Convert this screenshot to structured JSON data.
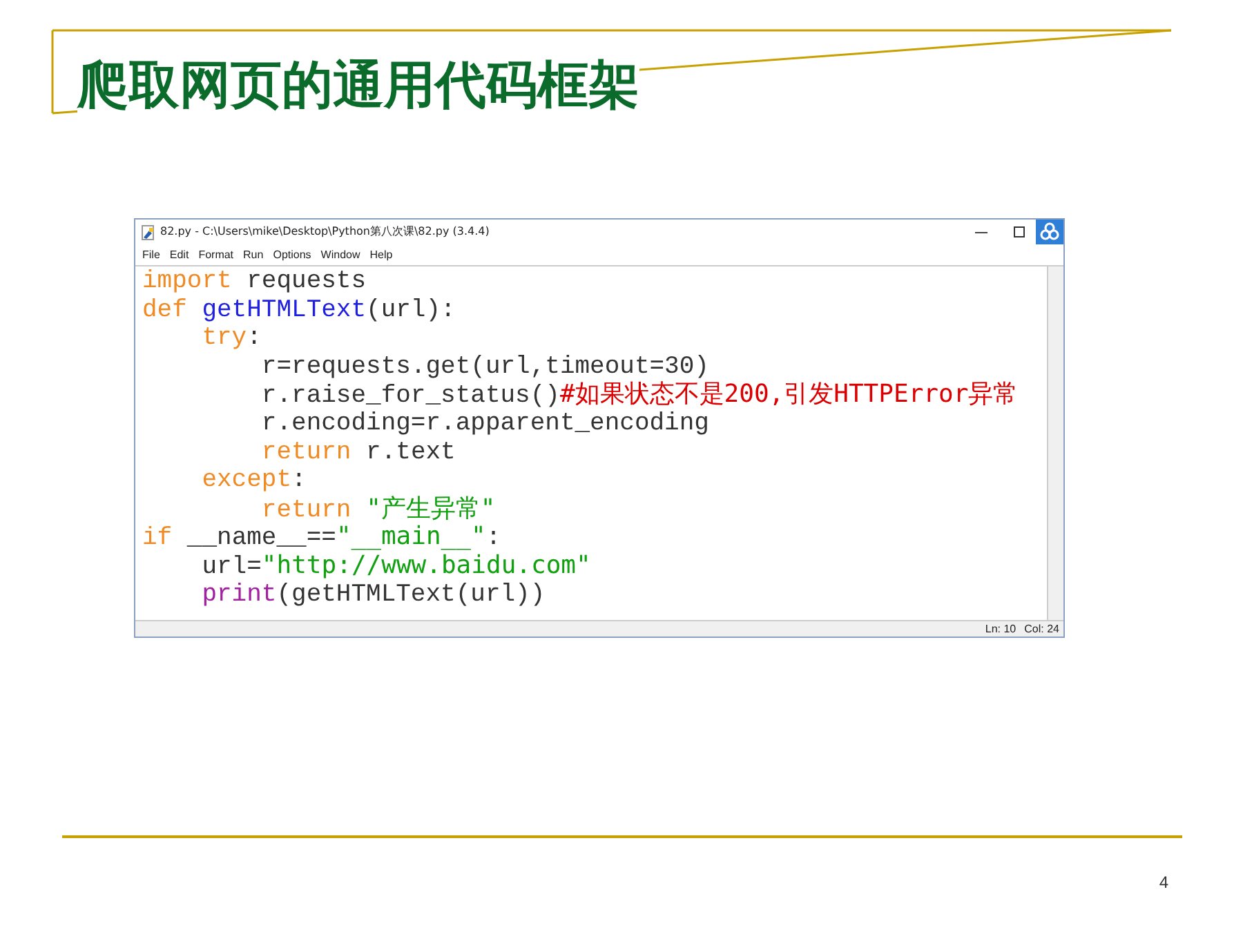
{
  "slide": {
    "title": "爬取网页的通用代码框架",
    "page_number": "4"
  },
  "window": {
    "title": "82.py - C:\\Users\\mike\\Desktop\\Python第八次课\\82.py (3.4.4)",
    "menu": [
      "File",
      "Edit",
      "Format",
      "Run",
      "Options",
      "Window",
      "Help"
    ],
    "code_lines": [
      [
        {
          "kind": "keyword",
          "text": "import"
        },
        {
          "kind": "plain",
          "text": " requests"
        }
      ],
      [
        {
          "kind": "keyword",
          "text": "def"
        },
        {
          "kind": "definition",
          "text": " getHTMLText"
        },
        {
          "kind": "plain",
          "text": "(url):"
        }
      ],
      [
        {
          "kind": "keyword",
          "text": "    try"
        },
        {
          "kind": "plain",
          "text": ":"
        }
      ],
      [
        {
          "kind": "plain",
          "text": "        r=requests.get(url,timeout=30)"
        }
      ],
      [
        {
          "kind": "plain",
          "text": "        r.raise_for_status()"
        },
        {
          "kind": "comment",
          "text": "#如果状态不是200,引发HTTPError异常"
        }
      ],
      [
        {
          "kind": "plain",
          "text": "        r.encoding=r.apparent_encoding"
        }
      ],
      [
        {
          "kind": "keyword",
          "text": "        return"
        },
        {
          "kind": "plain",
          "text": " r.text"
        }
      ],
      [
        {
          "kind": "keyword",
          "text": "    except"
        },
        {
          "kind": "plain",
          "text": ":"
        }
      ],
      [
        {
          "kind": "keyword",
          "text": "        return"
        },
        {
          "kind": "string",
          "text": " \"产生异常\""
        }
      ],
      [
        {
          "kind": "keyword",
          "text": "if"
        },
        {
          "kind": "plain",
          "text": " __name__=="
        },
        {
          "kind": "string",
          "text": "\"__main__\""
        },
        {
          "kind": "plain",
          "text": ":"
        }
      ],
      [
        {
          "kind": "plain",
          "text": "    url="
        },
        {
          "kind": "string",
          "text": "\"http://www.baidu.com\""
        }
      ],
      [
        {
          "kind": "builtin",
          "text": "    print"
        },
        {
          "kind": "plain",
          "text": "(getHTMLText(url))"
        }
      ]
    ],
    "status_bar": {
      "line": "Ln: 10",
      "column": "Col: 24"
    }
  }
}
